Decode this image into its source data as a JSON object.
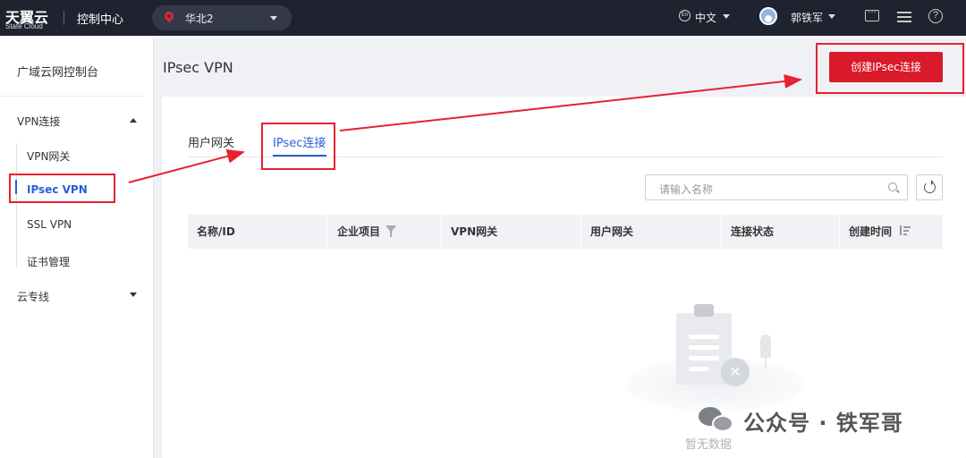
{
  "topbar": {
    "logo_text": "天翼云",
    "logo_sub": "State Cloud",
    "console_title": "控制中心",
    "region": "华北2",
    "language_icon": "En",
    "language": "中文",
    "user": "郭铁军",
    "help_icon": "?"
  },
  "sidebar": {
    "title": "广域云网控制台",
    "groups": [
      {
        "label": "VPN连接",
        "expanded": true
      },
      {
        "label": "云专线",
        "expanded": false
      }
    ],
    "items": [
      "VPN网关",
      "IPsec VPN",
      "SSL VPN",
      "证书管理"
    ],
    "active_item": "IPsec VPN"
  },
  "main": {
    "page_title": "IPsec VPN",
    "create_button": "创建IPsec连接",
    "tabs": [
      "用户网关",
      "IPsec连接"
    ],
    "active_tab": "IPsec连接",
    "search_placeholder": "请输入名称",
    "columns": [
      "名称/ID",
      "企业项目",
      "VPN网关",
      "用户网关",
      "连接状态",
      "创建时间"
    ],
    "empty_text": "暂无数据"
  },
  "watermark": {
    "text": "公众号 · 铁军哥"
  },
  "colors": {
    "topbar_bg": "#1f2330",
    "primary_button": "#d81a2a",
    "active_blue": "#2a5fd6",
    "annotation_red": "#e8202f"
  },
  "icons": [
    "location-pin-icon",
    "language-icon",
    "avatar-icon",
    "message-icon",
    "settings-icon",
    "help-icon",
    "filter-icon",
    "sort-icon",
    "search-icon",
    "refresh-icon",
    "empty-data-icon",
    "wechat-icon"
  ]
}
